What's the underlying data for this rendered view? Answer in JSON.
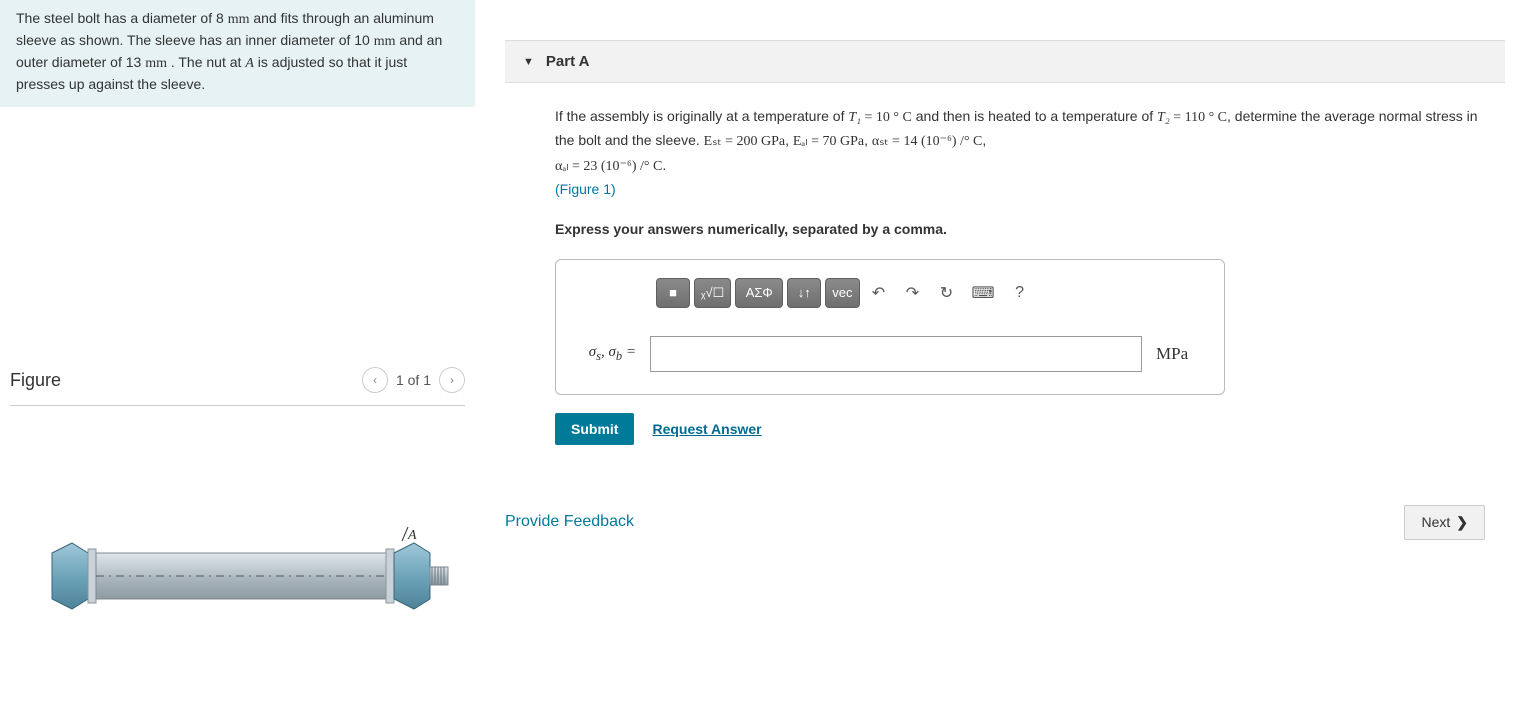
{
  "problem": {
    "text_parts": [
      "The steel bolt has a diameter of 8 ",
      "mm",
      " and fits through an aluminum sleeve as shown. The sleeve has an inner diameter of 10 ",
      "mm",
      " and an outer diameter of 13 ",
      "mm",
      " . The nut at ",
      "A",
      " is adjusted so that it just presses up against the sleeve."
    ]
  },
  "figure": {
    "title": "Figure",
    "counter": "1 of 1",
    "label_A": "A"
  },
  "part": {
    "label": "Part A",
    "question_prefix": "If the assembly is originally at a temperature of ",
    "T1_sym": "T₁",
    "T1_val": " = 10 °  C",
    "mid1": " and then is heated to a temperature of ",
    "T2_sym": "T₂",
    "T2_val": " = 110 °  C",
    "mid2": ", determine the average normal stress in the bolt and the sleeve. ",
    "Est": "Eₛₜ = 200 GPa",
    "sep1": ", ",
    "Eal": "Eₐₗ = 70 GPa",
    "sep2": ", ",
    "ast": "αₛₜ = 14 (10⁻⁶) /° C",
    "sep3": ", ",
    "aal": "αₐₗ = 23 (10⁻⁶) /° C",
    "period": ".",
    "figure_link": "(Figure 1)",
    "instruction": "Express your answers numerically, separated by a comma.",
    "answer_label": "σₛ, σ_b =",
    "unit": "MPa",
    "submit": "Submit",
    "request": "Request Answer"
  },
  "toolbar": {
    "template": "■",
    "sqrt": "ᵪ√☐",
    "greek": "ΑΣΦ",
    "subsup": "↓↑",
    "vec": "vec",
    "undo": "↶",
    "redo": "↷",
    "reset": "↻",
    "keyboard": "⌨",
    "help": "?"
  },
  "footer": {
    "feedback": "Provide Feedback",
    "next": "Next"
  }
}
